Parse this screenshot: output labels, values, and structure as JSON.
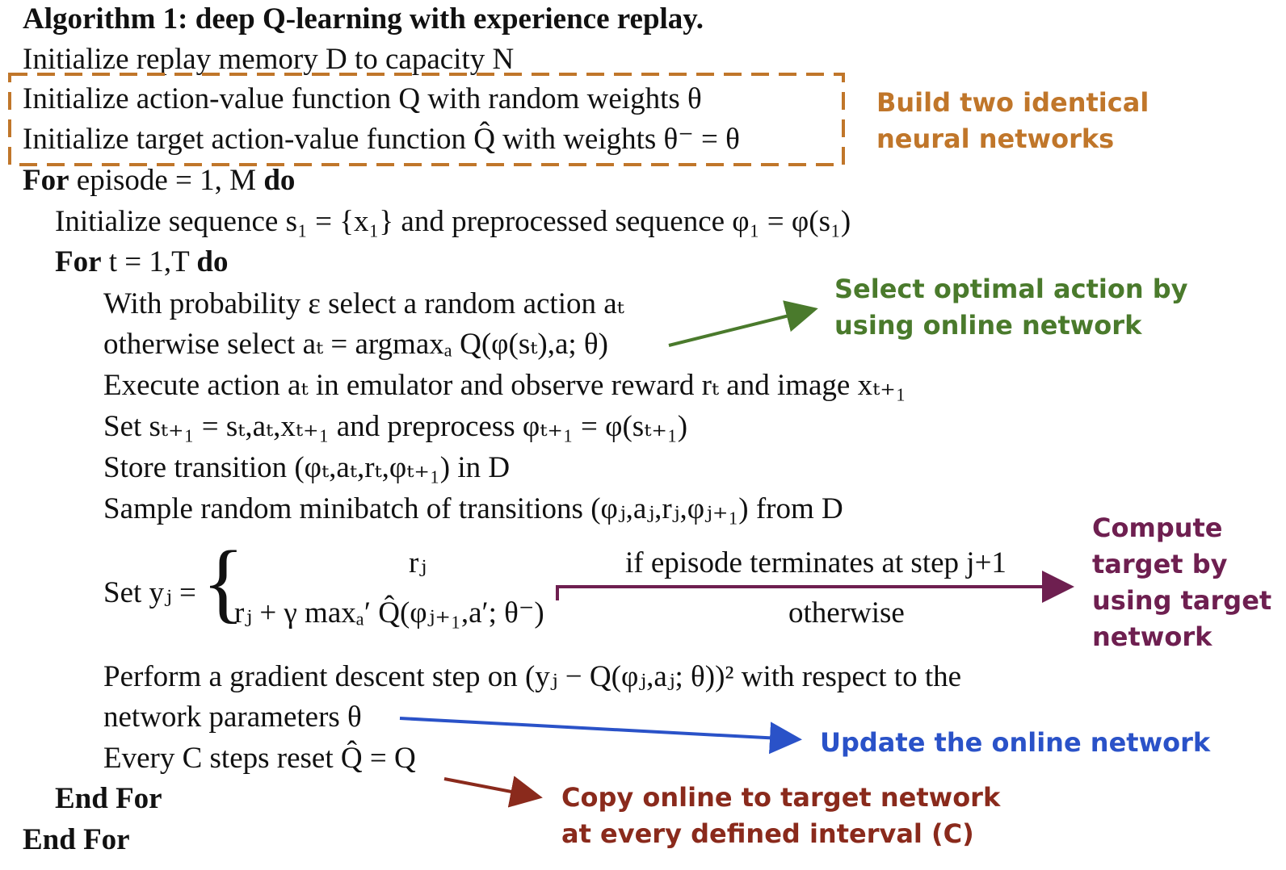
{
  "algorithm": {
    "title": "Algorithm 1: deep Q-learning with experience replay.",
    "lines": {
      "init_memory": "Initialize replay memory D to capacity N",
      "init_q": "Initialize action-value function Q with random weights θ",
      "init_target": "Initialize target action-value function Q̂ with weights θ⁻ = θ",
      "for_episode_kw": "For",
      "for_episode_mid": "episode = 1, M",
      "for_episode_do": "do",
      "init_sequence": "Initialize sequence s₁ = {x₁} and preprocessed sequence φ₁ = φ(s₁)",
      "for_t_kw": "For",
      "for_t_mid": "t = 1,T",
      "for_t_do": "do",
      "with_prob": "With probability ε select a random action aₜ",
      "otherwise_select": "otherwise select aₜ = argmaxₐ Q(φ(sₜ),a; θ)",
      "execute": "Execute action aₜ in emulator and observe reward rₜ and image xₜ₊₁",
      "set_s": "Set sₜ₊₁ = sₜ,aₜ,xₜ₊₁ and preprocess φₜ₊₁ = φ(sₜ₊₁)",
      "store": "Store transition (φₜ,aₜ,rₜ,φₜ₊₁) in D",
      "sample": "Sample random minibatch of transitions (φⱼ,aⱼ,rⱼ,φⱼ₊₁) from D",
      "set_y_label": "Set yⱼ =",
      "case1_value": "rⱼ",
      "case1_condition": "if episode terminates at step j+1",
      "case2_value": "rⱼ + γ maxₐ′ Q̂(φⱼ₊₁,a′; θ⁻)",
      "case2_condition": "otherwise",
      "gradient": "Perform a gradient descent step on (yⱼ − Q(φⱼ,aⱼ; θ))² with respect to the",
      "gradient_cont": "network parameters θ",
      "reset": "Every C steps reset Q̂ = Q",
      "end_inner": "End For",
      "end_outer": "End For"
    }
  },
  "annotations": {
    "build_networks": {
      "line1": "Build two identical",
      "line2": "neural networks",
      "color": "#C0762A"
    },
    "select_action": {
      "line1": "Select optimal action by",
      "line2": "using online network",
      "color": "#4A7A2C"
    },
    "compute_target": {
      "line1": "Compute",
      "line2": "target by",
      "line3": "using target",
      "line4": "network",
      "color": "#6E1F50"
    },
    "update_online": {
      "line1": "Update the online network",
      "color": "#2A52C8"
    },
    "copy_online": {
      "line1": "Copy online to target network",
      "line2": "at every defined interval (C)",
      "color": "#8A2A1C"
    }
  }
}
